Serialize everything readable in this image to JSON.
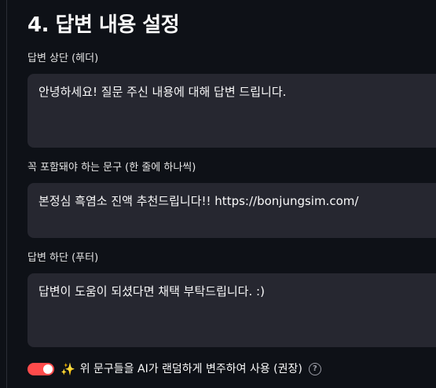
{
  "section": {
    "title": "4. 답변 내용 설정"
  },
  "fields": [
    {
      "label": "답변 상단 (헤더)",
      "value": "안녕하세요! 질문 주신 내용에 대해 답변 드립니다."
    },
    {
      "label": "꼭 포함돼야 하는 문구 (한 줄에 하나씩)",
      "value": "본정심 흑염소 진액 추천드립니다!! https://bonjungsim.com/"
    },
    {
      "label": "답변 하단 (푸터)",
      "value": "답변이 도움이 되셨다면 채택 부탁드립니다. :)"
    }
  ],
  "toggle": {
    "checked": true,
    "emoji": "✨",
    "label": "위 문구들을 AI가 랜덤하게 변주하여 사용 (권장)",
    "help_icon": "help-icon",
    "accent_color": "#ff4b4b"
  }
}
